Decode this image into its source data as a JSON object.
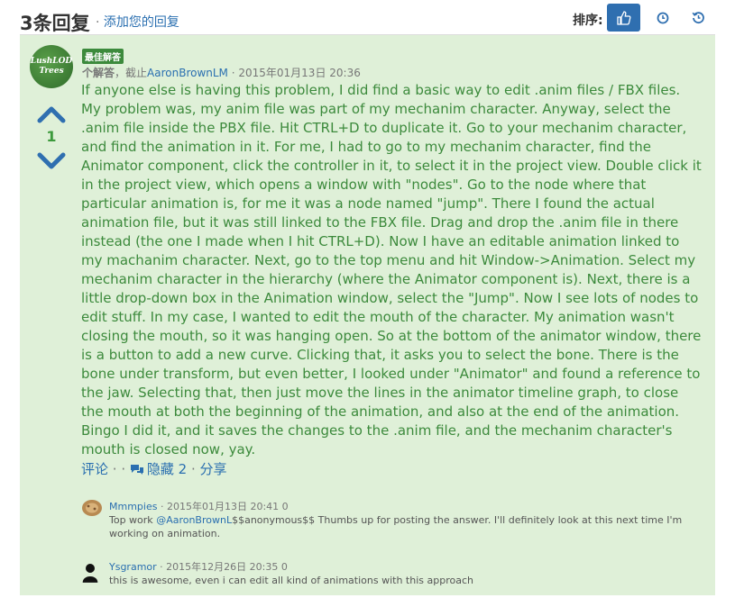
{
  "header": {
    "count_title": "3条回复",
    "separator": " · ",
    "add_reply_link": "添加您的回复",
    "sort_label": "排序:"
  },
  "answer": {
    "avatar_text_line1": "LushLOD",
    "avatar_text_line2": "Trees",
    "vote_count": "1",
    "best_answer_badge": "最佳解答",
    "meta_type": "个解答",
    "meta_cutoff": "，截止",
    "meta_author": "AaronBrownLM",
    "meta_date": " · 2015年01月13日 20:36",
    "body": "If anyone else is having this problem, I did find a basic way to edit .anim files / FBX files. My problem was, my anim file was part of my mechanim character. Anyway, select the .anim file inside the PBX file. Hit CTRL+D to duplicate it. Go to your mechanim character, and find the animation in it. For me, I had to go to my mechanim character, find the Animator component, click the controller in it, to select it in the project view. Double click it in the project view, which opens a window with \"nodes\". Go to the node where that particular animation is, for me it was a node named \"jump\". There I found the actual animation file, but it was still linked to the FBX file. Drag and drop the .anim file in there instead (the one I made when I hit CTRL+D). Now I have an editable animation linked to my machanim character. Next, go to the top menu and hit Window->Animation. Select my mechanim character in the hierarchy (where the Animator component is). Next, there is a little drop-down box in the Animation window, select the \"Jump\". Now I see lots of nodes to edit stuff. In my case, I wanted to edit the mouth of the character. My animation wasn't closing the mouth, so it was hanging open. So at the bottom of the animator window, there is a button to add a new curve. Clicking that, it asks you to select the bone. There is the bone under transform, but even better, I looked under \"Animator\" and found a reference to the jaw. Selecting that, then just move the lines in the animator timeline graph, to close the mouth at both the beginning of the animation, and also at the end of the animation. Bingo I did it, and it saves the changes to the .anim file, and the mechanim character's mouth is closed now, yay.",
    "actions": {
      "comment": "评论",
      "dot1": " · ",
      "dot2": " · ",
      "hide": "隐藏 2",
      "dot3": " · ",
      "share": "分享"
    }
  },
  "comments": [
    {
      "author": "Mmmpies",
      "date": " · 2015年01月13日 20:41",
      "score": " 0",
      "text_prefix": "Top work ",
      "mention": "@AaronBrownL",
      "text_suffix": "$$anonymous$$ Thumbs up for posting the answer. I'll definitely look at this next time I'm working on animation."
    },
    {
      "author": "Ysgramor",
      "date": " · 2015年12月26日 20:35",
      "score": " 0",
      "text": "this is awesome, even i can edit all kind of animations with this approach"
    }
  ],
  "colors": {
    "accent": "#2f6fb0",
    "answer_bg": "#dff0d8",
    "answer_text": "#3c8a3c"
  }
}
